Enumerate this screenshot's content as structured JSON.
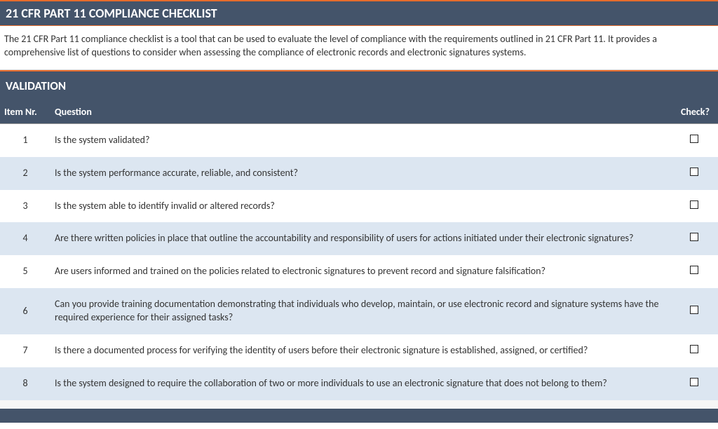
{
  "header": {
    "title": "21 CFR PART 11 COMPLIANCE CHECKLIST"
  },
  "intro": "The 21 CFR Part 11 compliance checklist is a tool that can be used to evaluate the level of compliance with the requirements outlined in 21 CFR Part 11. It provides a comprehensive list of questions to consider when assessing the compliance of electronic records and electronic signatures systems.",
  "section": {
    "title": "VALIDATION"
  },
  "columns": {
    "item": "Item Nr.",
    "question": "Question",
    "check": "Check?"
  },
  "rows": [
    {
      "nr": "1",
      "question": "Is the system validated?"
    },
    {
      "nr": "2",
      "question": "Is the system performance accurate, reliable, and consistent?"
    },
    {
      "nr": "3",
      "question": "Is the system able to identify invalid or altered records?"
    },
    {
      "nr": "4",
      "question": "Are there written policies in place that outline the accountability and responsibility of users for actions initiated under their electronic signatures?"
    },
    {
      "nr": "5",
      "question": "Are users informed and trained on the policies related to electronic signatures to prevent record and signature falsification?"
    },
    {
      "nr": "6",
      "question": "Can you provide training documentation demonstrating that individuals who develop, maintain, or use electronic record and signature systems have the required experience for their assigned tasks?"
    },
    {
      "nr": "7",
      "question": "Is there a documented process for verifying the identity of users before their electronic signature is established, assigned, or certified?"
    },
    {
      "nr": "8",
      "question": "Is the system designed to require the collaboration of two or more individuals to use an electronic signature that does not belong to them?"
    }
  ]
}
